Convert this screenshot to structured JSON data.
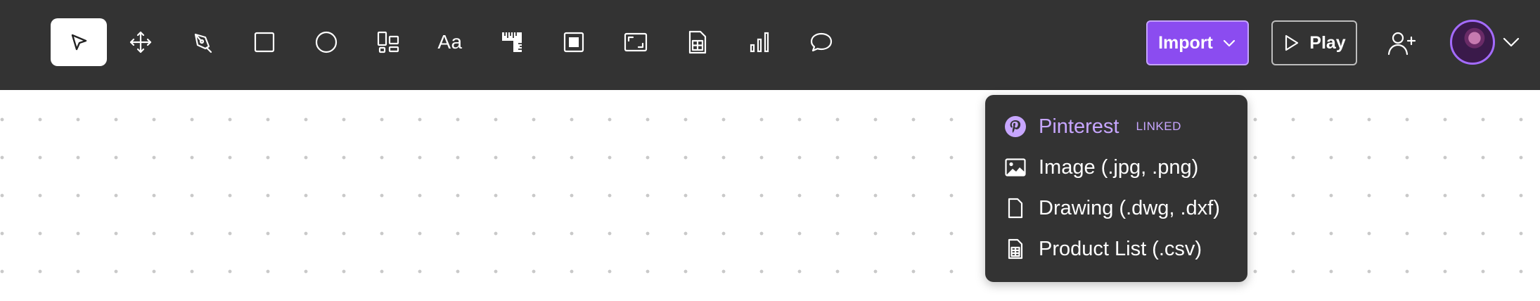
{
  "toolbar": {
    "tools": [
      {
        "icon": "select-arrow-icon",
        "active": true
      },
      {
        "icon": "move-icon",
        "active": false
      },
      {
        "icon": "pen-icon",
        "active": false
      },
      {
        "icon": "rectangle-icon",
        "active": false
      },
      {
        "icon": "ellipse-icon",
        "active": false
      },
      {
        "icon": "layout-grid-icon",
        "active": false
      },
      {
        "icon": "text-icon",
        "label": "Aa",
        "active": false
      },
      {
        "icon": "ruler-icon",
        "active": false
      },
      {
        "icon": "frame-icon",
        "active": false
      },
      {
        "icon": "resize-icon",
        "active": false
      },
      {
        "icon": "spreadsheet-icon",
        "active": false
      },
      {
        "icon": "bar-chart-icon",
        "active": false
      },
      {
        "icon": "comment-icon",
        "active": false
      }
    ],
    "import_label": "Import",
    "play_label": "Play",
    "add_user_icon": "add-user-icon",
    "avatar_icon": "user-avatar"
  },
  "import_menu": {
    "items": [
      {
        "label": "Pinterest",
        "badge": "LINKED",
        "icon": "pinterest-icon"
      },
      {
        "label": "Image (.jpg, .png)",
        "icon": "image-icon"
      },
      {
        "label": "Drawing (.dwg, .dxf)",
        "icon": "file-icon"
      },
      {
        "label": "Product List (.csv)",
        "icon": "spreadsheet-file-icon"
      }
    ]
  },
  "colors": {
    "toolbar_bg": "#333333",
    "accent": "#8b4cf0",
    "menu_bg": "#333333",
    "pinterest_text": "#c7a6ff"
  }
}
